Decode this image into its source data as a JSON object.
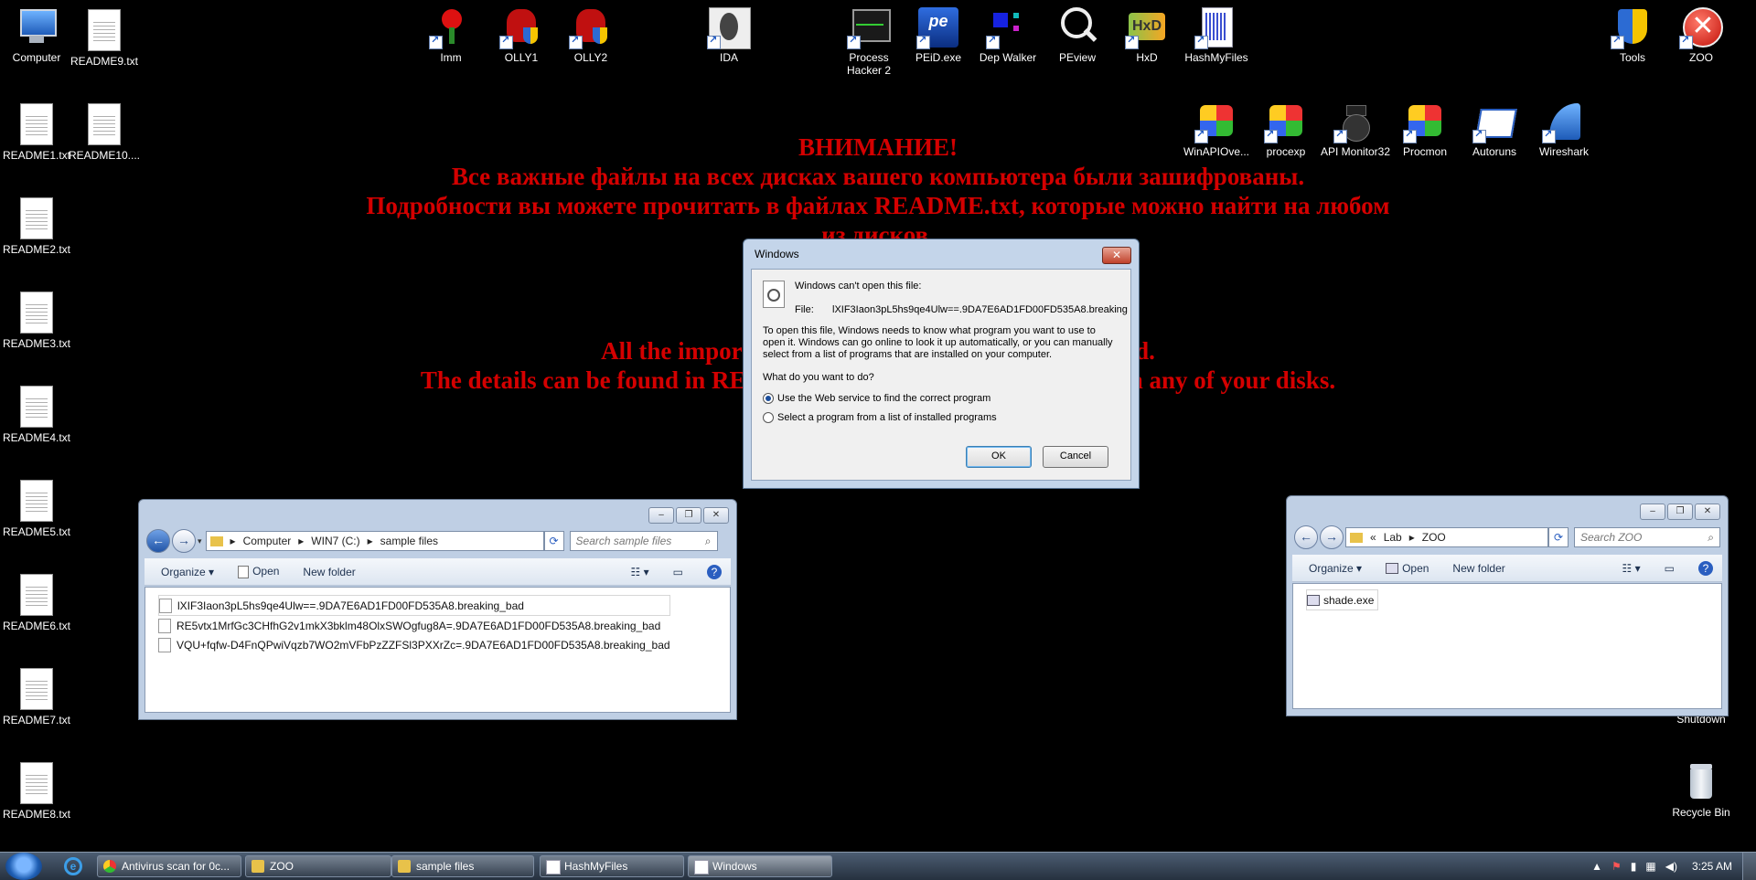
{
  "desktop": {
    "left_icons": [
      "Computer",
      "README9.txt",
      "README1.txt",
      "README10....",
      "README2.txt",
      "README3.txt",
      "README4.txt",
      "README5.txt",
      "README6.txt",
      "README7.txt",
      "README8.txt"
    ],
    "top_icons": [
      "Imm",
      "OLLY1",
      "OLLY2",
      "IDA",
      "Process Hacker 2",
      "PEiD.exe",
      "Dep Walker",
      "PEview",
      "HxD",
      "HashMyFiles",
      "Tools",
      "ZOO"
    ],
    "second_row_icons": [
      "WinAPIOve...",
      "procexp",
      "API Monitor32",
      "Procmon",
      "Autoruns",
      "Wireshark"
    ],
    "right_icons": [
      "Shutdown",
      "Recycle Bin"
    ]
  },
  "ransom_note": {
    "line1": "ВНИМАНИЕ!",
    "line2": "Все важные файлы на всех дисках вашего компьютера были зашифрованы.",
    "line3": "Подробности вы можете прочитать в файлах README.txt, которые можно найти на любом",
    "line4": "из дисков.",
    "line5": "All the important files on your disks were encrypted.",
    "line6": "The details can be found in README.txt files which you can find on any of your disks."
  },
  "sample_window": {
    "breadcrumb": [
      "Computer",
      "WIN7 (C:)",
      "sample files"
    ],
    "search_placeholder": "Search sample files",
    "toolbar": {
      "organize": "Organize ▾",
      "open": "Open",
      "new_folder": "New folder"
    },
    "files": [
      "lXIF3Iaon3pL5hs9qe4Ulw==.9DA7E6AD1FD00FD535A8.breaking_bad",
      "RE5vtx1MrfGc3CHfhG2v1mkX3bklm48OlxSWOgfug8A=.9DA7E6AD1FD00FD535A8.breaking_bad",
      "VQU+fqfw-D4FnQPwiVqzb7WO2mVFbPzZZFSl3PXXrZc=.9DA7E6AD1FD00FD535A8.breaking_bad"
    ]
  },
  "zoo_window": {
    "breadcrumb": [
      "«",
      "Lab",
      "ZOO"
    ],
    "search_placeholder": "Search ZOO",
    "toolbar": {
      "organize": "Organize ▾",
      "open": "Open",
      "new_folder": "New folder"
    },
    "files": [
      "shade.exe"
    ]
  },
  "dialog": {
    "title": "Windows",
    "close": "✕",
    "cant_open": "Windows can't open this file:",
    "file_label": "File:",
    "file_name": "lXIF3Iaon3pL5hs9qe4Ulw==.9DA7E6AD1FD00FD535A8.breaking",
    "explanation": "To open this file, Windows needs to know what program you want to use to open it. Windows can go online to look it up automatically, or you can manually select from a list of programs that are installed on your computer.",
    "question": "What do you want to do?",
    "option1": "Use the Web service to find the correct program",
    "option2": "Select a program from a list of installed programs",
    "ok": "OK",
    "cancel": "Cancel"
  },
  "taskbar": {
    "items": [
      "Antivirus scan for 0c...",
      "ZOO",
      "sample files",
      "HashMyFiles",
      "Windows"
    ],
    "clock": "3:25 AM"
  }
}
